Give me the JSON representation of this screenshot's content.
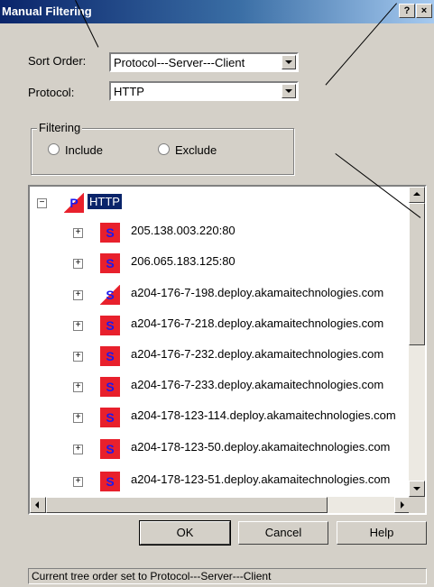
{
  "window": {
    "title": "Manual Filtering",
    "help_glyph": "?",
    "close_glyph": "×"
  },
  "sort_order": {
    "label": "Sort Order:",
    "value": "Protocol---Server---Client"
  },
  "protocol": {
    "label": "Protocol:",
    "value": "HTTP"
  },
  "filtering": {
    "legend": "Filtering",
    "options": [
      {
        "label": "Include"
      },
      {
        "label": "Exclude"
      }
    ]
  },
  "tree": {
    "root": {
      "icon_letter": "P",
      "label": "HTTP"
    },
    "items": [
      {
        "icon_letter": "S",
        "label": "205.138.003.220:80"
      },
      {
        "icon_letter": "S",
        "label": "206.065.183.125:80"
      },
      {
        "icon_letter": "S",
        "label": "a204-176-7-198.deploy.akamaitechnologies.com"
      },
      {
        "icon_letter": "S",
        "label": "a204-176-7-218.deploy.akamaitechnologies.com"
      },
      {
        "icon_letter": "S",
        "label": "a204-176-7-232.deploy.akamaitechnologies.com"
      },
      {
        "icon_letter": "S",
        "label": "a204-176-7-233.deploy.akamaitechnologies.com"
      },
      {
        "icon_letter": "S",
        "label": "a204-178-123-114.deploy.akamaitechnologies.com"
      },
      {
        "icon_letter": "S",
        "label": "a204-178-123-50.deploy.akamaitechnologies.com"
      },
      {
        "icon_letter": "S",
        "label": "a204-178-123-51.deploy.akamaitechnologies.com"
      }
    ]
  },
  "buttons": {
    "ok": "OK",
    "cancel": "Cancel",
    "help": "Help"
  },
  "status": "Current tree order set to Protocol---Server---Client",
  "colors": {
    "icon_red": "#e8202c",
    "icon_letter": "#1a1af0",
    "title_blue": "#0a246a"
  }
}
